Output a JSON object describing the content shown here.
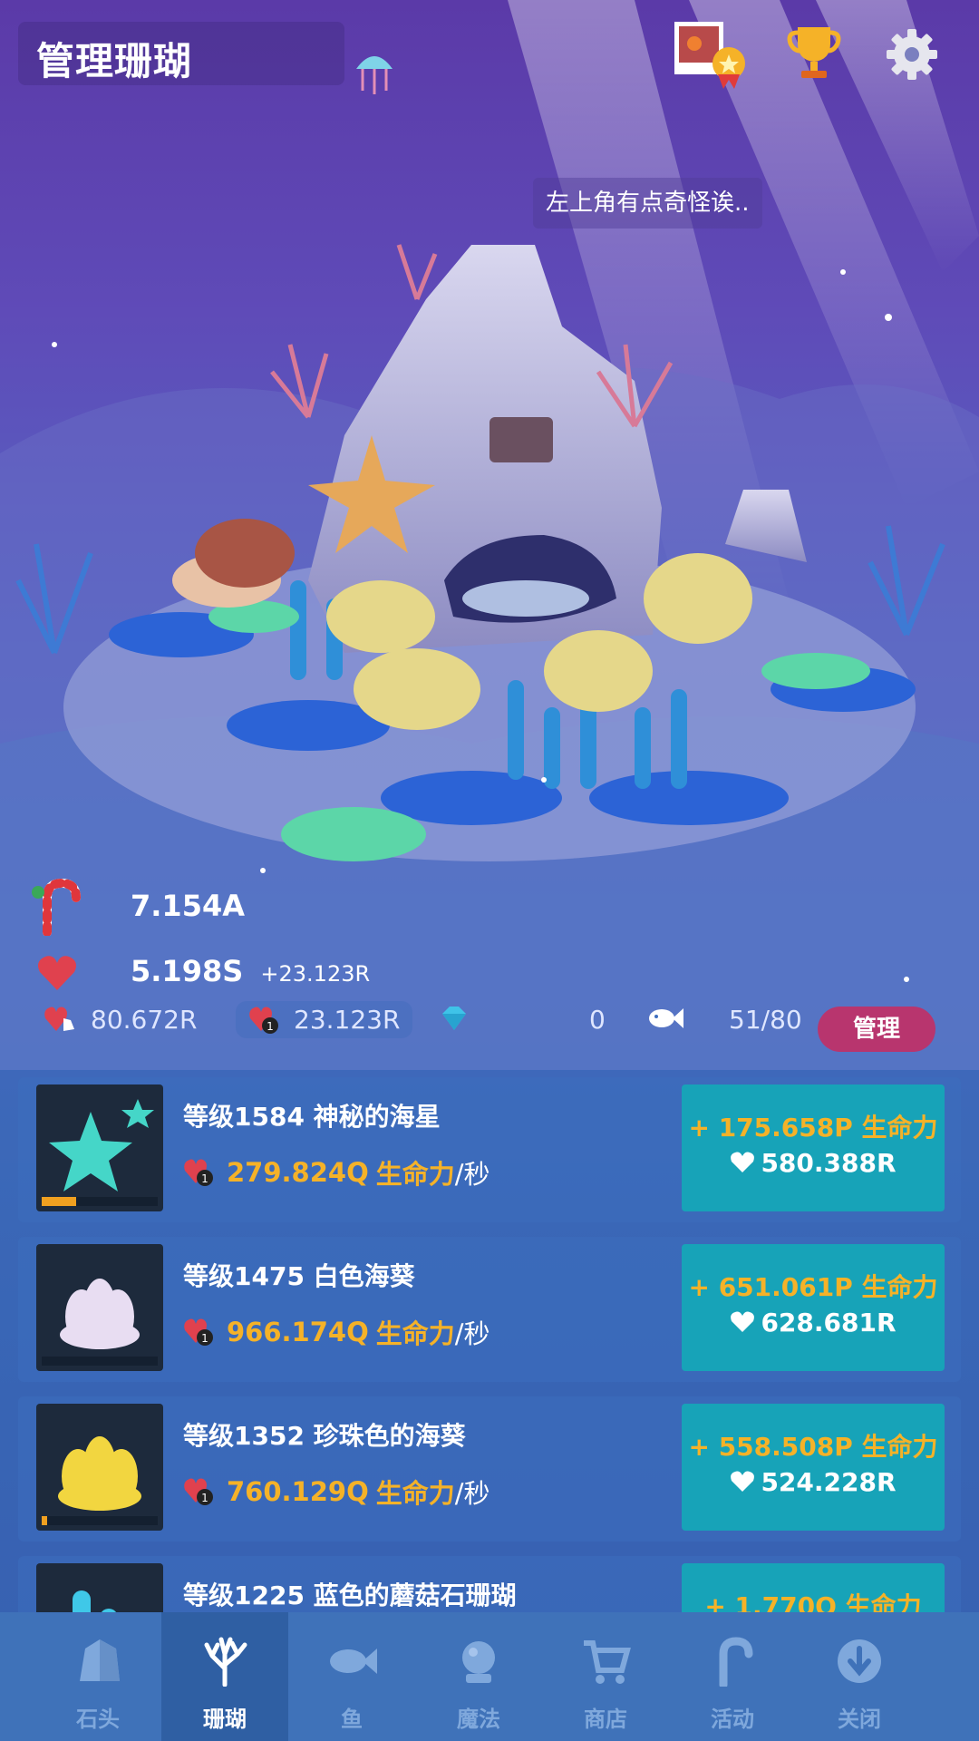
{
  "header": {
    "title": "管理珊瑚"
  },
  "speech_bubble": "左上角有点奇怪诶..",
  "stats": {
    "candy_value": "7.154A",
    "vitality_value": "5.198S",
    "vitality_rate": "+23.123R",
    "tap_value": "80.672R",
    "boost_value": "23.123R",
    "gem_value": "0",
    "fish_count": "51/80",
    "manage_label": "管理"
  },
  "corals": [
    {
      "title": "等级1584 神秘的海星",
      "rate": "279.824Q",
      "rate_unit": "生命力",
      "rate_suffix": "/秒",
      "gain": "+ 175.658P 生命力",
      "cost": "580.388R",
      "progress": 0.3
    },
    {
      "title": "等级1475 白色海葵",
      "rate": "966.174Q",
      "rate_unit": "生命力",
      "rate_suffix": "/秒",
      "gain": "+ 651.061P 生命力",
      "cost": "628.681R",
      "progress": 0.0
    },
    {
      "title": "等级1352 珍珠色的海葵",
      "rate": "760.129Q",
      "rate_unit": "生命力",
      "rate_suffix": "/秒",
      "gain": "+ 558.508P 生命力",
      "cost": "524.228R",
      "progress": 0.05
    },
    {
      "title": "等级1225 蓝色的蘑菇石珊瑚",
      "rate": "",
      "rate_unit": "",
      "rate_suffix": "",
      "gain": "+ 1.770Q 生命力",
      "cost": "",
      "progress": 0.0
    }
  ],
  "tabs": [
    {
      "label": "石头",
      "icon": "rock-icon",
      "active": false
    },
    {
      "label": "珊瑚",
      "icon": "coral-icon",
      "active": true
    },
    {
      "label": "鱼",
      "icon": "fish-icon",
      "active": false
    },
    {
      "label": "魔法",
      "icon": "magic-icon",
      "active": false
    },
    {
      "label": "商店",
      "icon": "cart-icon",
      "active": false
    },
    {
      "label": "活动",
      "icon": "candy-cane-icon",
      "active": false
    },
    {
      "label": "关闭",
      "icon": "close-down-icon",
      "active": false
    }
  ],
  "colors": {
    "accent_gold": "#f5b228",
    "button_teal": "#17a3b8",
    "manage_pink": "#b8356e",
    "tab_active": "#2f5fa3"
  }
}
